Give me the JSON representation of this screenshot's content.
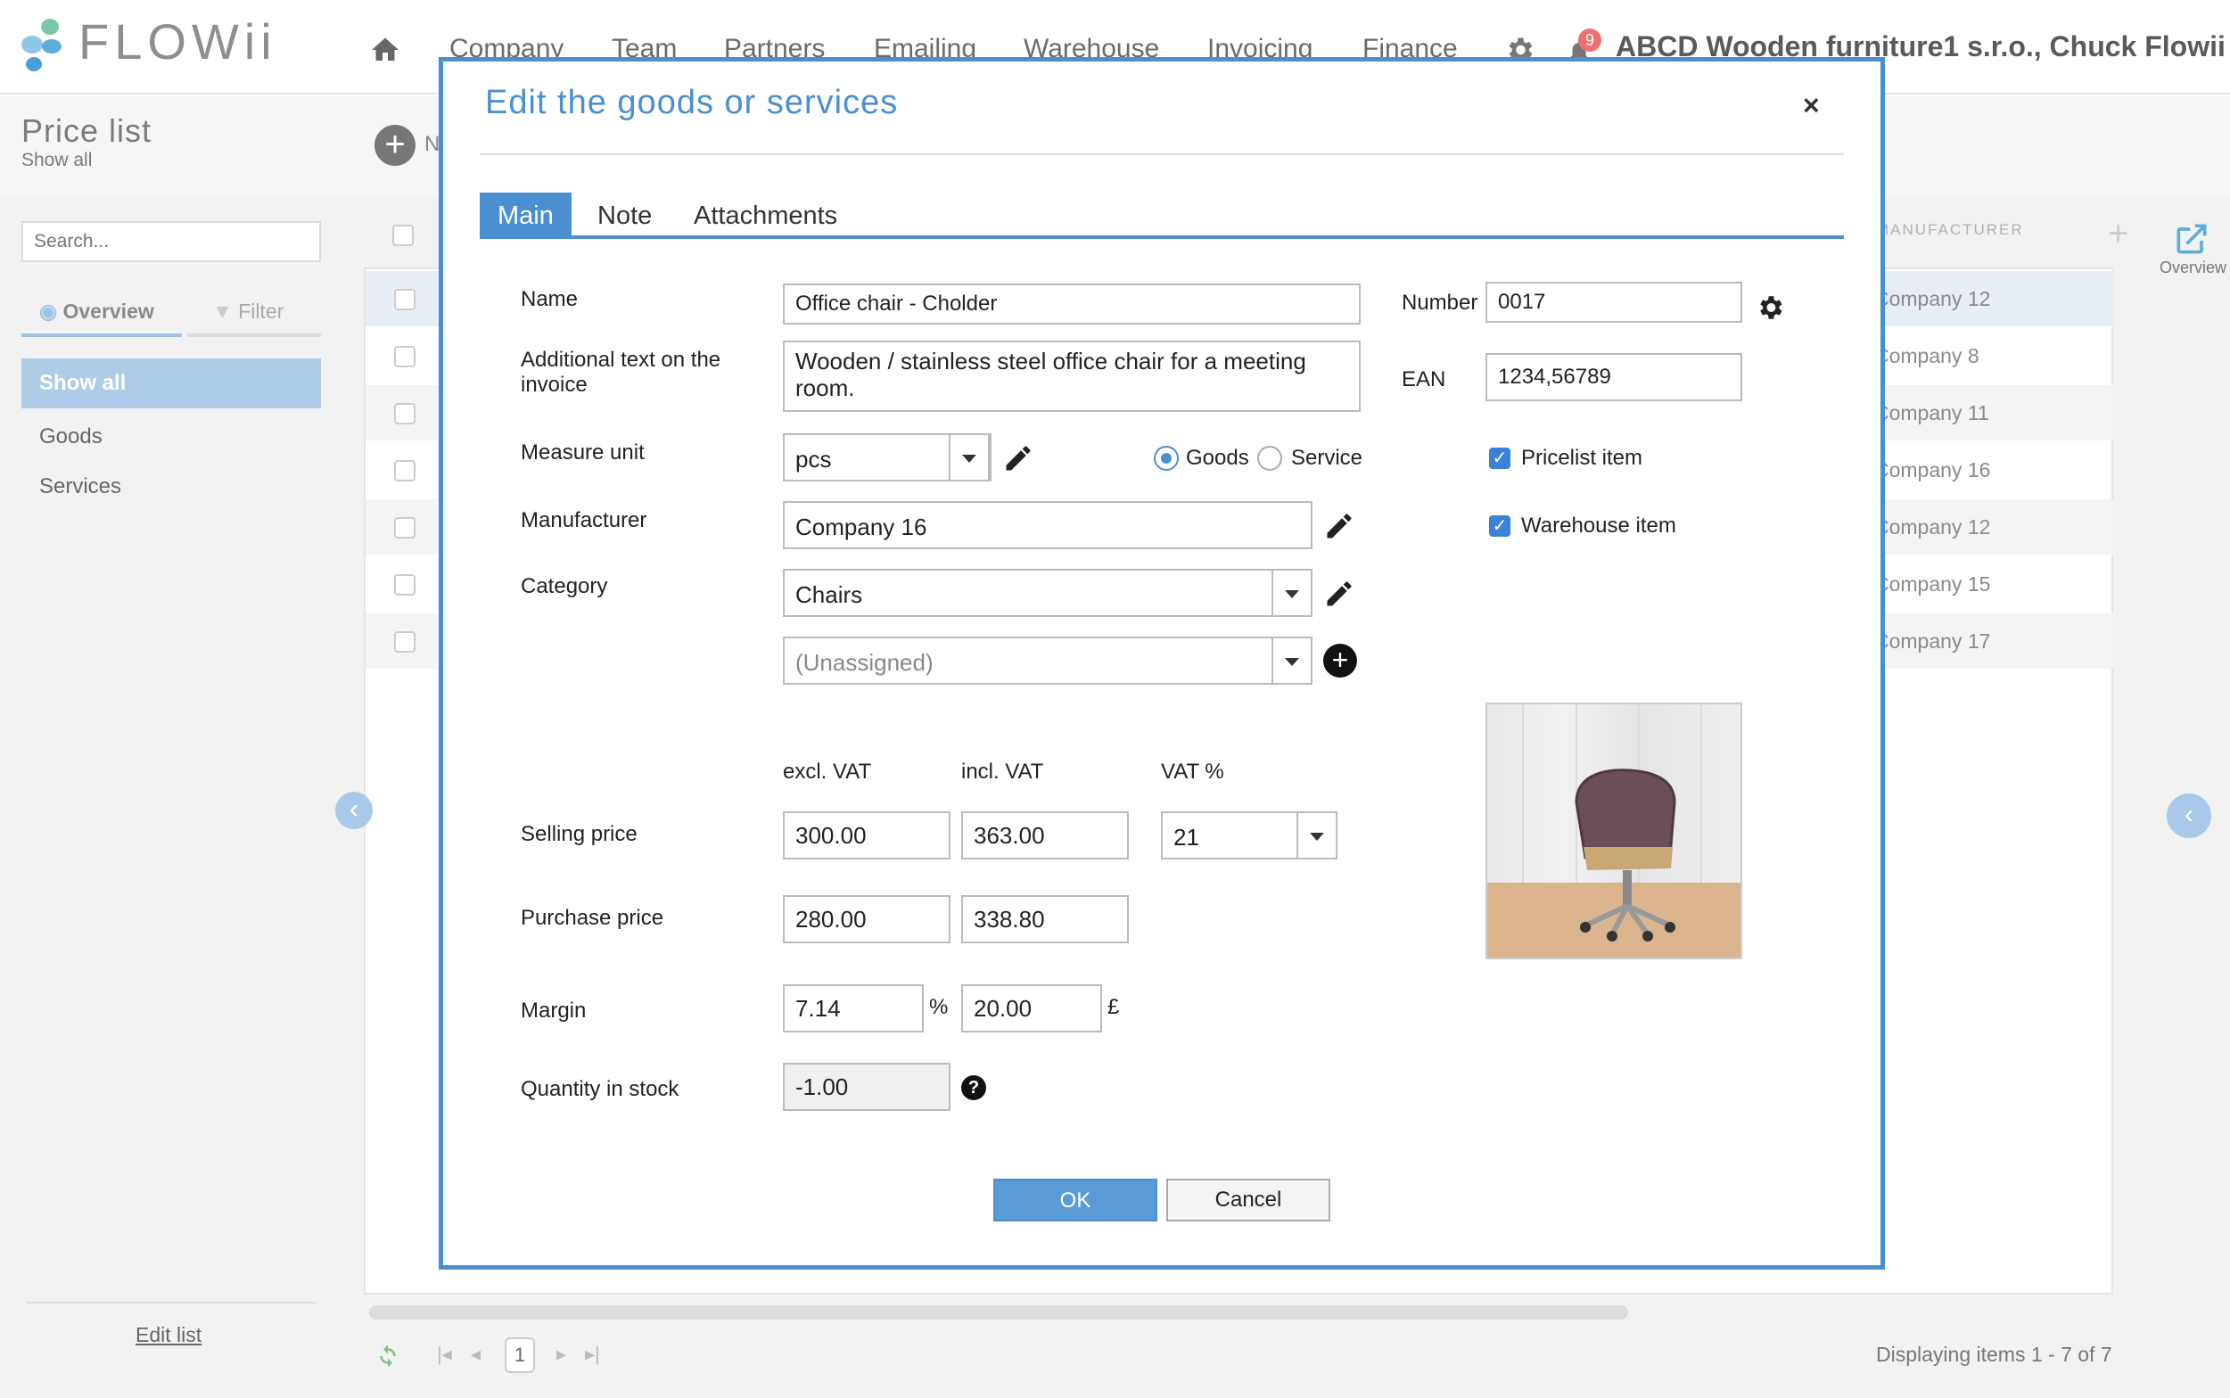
{
  "header": {
    "logo_text": "FLOWii",
    "nav": [
      "Company",
      "Team",
      "Partners",
      "Emailing",
      "Warehouse",
      "Invoicing",
      "Finance"
    ],
    "notification_count": "9",
    "company_user": "ABCD Wooden furniture1 s.r.o., Chuck Flowii"
  },
  "sidebar": {
    "title": "Price list",
    "subtitle": "Show all",
    "search_placeholder": "Search...",
    "tabs": {
      "overview": "Overview",
      "filter": "Filter"
    },
    "items": [
      "Show all",
      "Goods",
      "Services"
    ],
    "edit_list": "Edit list"
  },
  "grid": {
    "manufacturer_header": "MANUFACTURER",
    "overview_label": "Overview",
    "manufacturers": [
      "Company 12",
      "Company 8",
      "Company 11",
      "Company 16",
      "Company 12",
      "Company 15",
      "Company 17"
    ],
    "page": "1",
    "items_info": "Displaying items 1 - 7 of 7",
    "new_button_partial": "N"
  },
  "dialog": {
    "title": "Edit the goods or services",
    "close": "×",
    "tabs": [
      "Main",
      "Note",
      "Attachments"
    ],
    "labels": {
      "name": "Name",
      "additional_text": "Additional text on the invoice",
      "measure_unit": "Measure unit",
      "manufacturer": "Manufacturer",
      "category": "Category",
      "number": "Number",
      "ean": "EAN",
      "goods": "Goods",
      "service": "Service",
      "pricelist_item": "Pricelist item",
      "warehouse_item": "Warehouse item",
      "excl_vat": "excl. VAT",
      "incl_vat": "incl. VAT",
      "vat_pct": "VAT %",
      "selling_price": "Selling price",
      "purchase_price": "Purchase price",
      "margin": "Margin",
      "quantity_in_stock": "Quantity in stock",
      "percent_sign": "%",
      "currency_sign": "£"
    },
    "values": {
      "name": "Office chair - Cholder",
      "additional_text": "Wooden / stainless steel office chair for a meeting room.",
      "measure_unit": "pcs",
      "manufacturer": "Company 16",
      "category": "Chairs",
      "subcategory_placeholder": "(Unassigned)",
      "number": "0017",
      "ean": "1234,56789",
      "selling_excl": "300.00",
      "selling_incl": "363.00",
      "vat": "21",
      "purchase_excl": "280.00",
      "purchase_incl": "338.80",
      "margin_pct": "7.14",
      "margin_amount": "20.00",
      "quantity_in_stock": "-1.00",
      "type_selected": "Goods",
      "pricelist_item_checked": true,
      "warehouse_item_checked": true
    },
    "buttons": {
      "ok": "OK",
      "cancel": "Cancel"
    }
  },
  "colors": {
    "accent": "#4a8fd0",
    "sidebar_active": "#aecbe7",
    "notification": "#f07070"
  }
}
